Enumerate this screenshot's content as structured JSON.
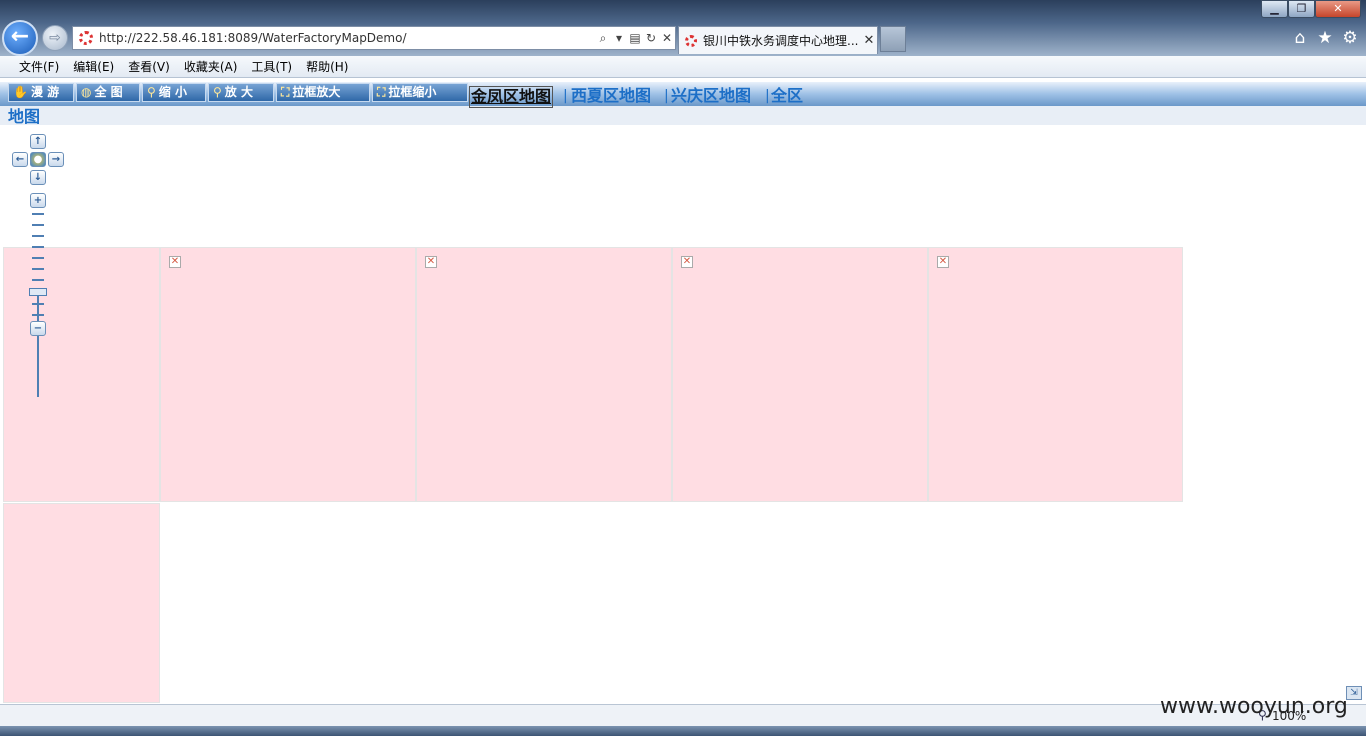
{
  "window": {
    "minimize": "▁",
    "maximize": "❐",
    "close": "✕"
  },
  "nav": {
    "back": "←",
    "forward": "⇨"
  },
  "address": {
    "url": "http://222.58.46.181:8089/WaterFactoryMapDemo/",
    "search_icon": "search-icon",
    "compat_icon": "compat-view-icon",
    "refresh_icon": "refresh-icon",
    "stop_icon": "stop-icon"
  },
  "tab": {
    "title": "银川中铁水务调度中心地理...",
    "close": "✕"
  },
  "menu": [
    "文件(F)",
    "编辑(E)",
    "查看(V)",
    "收藏夹(A)",
    "工具(T)",
    "帮助(H)"
  ],
  "toolbar": {
    "pan": "漫 游",
    "full": "全 图",
    "zoom_out": "缩 小",
    "zoom_in": "放 大",
    "box_zoom_in": "拉框放大",
    "box_zoom_out": "拉框缩小"
  },
  "regions": {
    "jinfeng": "金凤区地图",
    "xixia": "西夏区地图",
    "xingqing": "兴庆区地图",
    "all_part1": "全区",
    "all_part2": "地图",
    "separator": "|"
  },
  "map": {
    "broken_image_glyph": "✕",
    "zoom_plus": "+",
    "zoom_minus": "−"
  },
  "status": {
    "zoom": "100%"
  },
  "watermark": "www.wooyun.org"
}
